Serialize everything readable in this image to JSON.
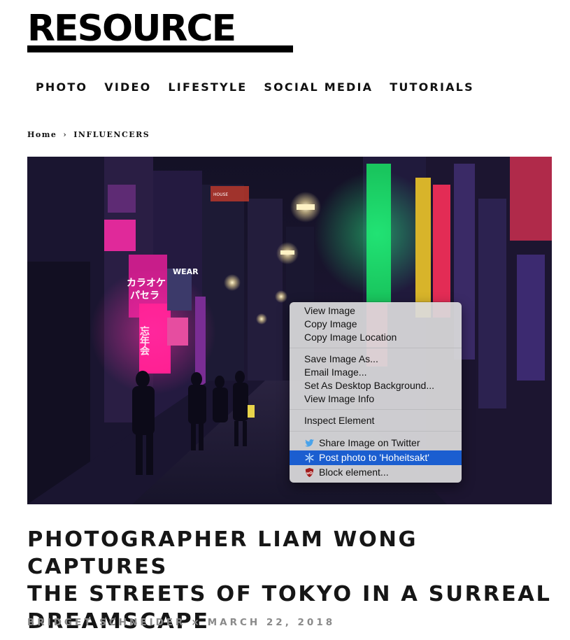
{
  "site": {
    "logo": "RESOURCE"
  },
  "nav": {
    "items": [
      "PHOTO",
      "VIDEO",
      "LIFESTYLE",
      "SOCIAL MEDIA",
      "TUTORIALS"
    ]
  },
  "breadcrumb": {
    "home": "Home",
    "separator": "›",
    "current": "INFLUENCERS"
  },
  "hero": {
    "signs": [
      "カラオケ",
      "パセラ",
      "忘年会",
      "WEAR",
      "HOUSE"
    ]
  },
  "context_menu": {
    "items": [
      "View Image",
      "Copy Image",
      "Copy Image Location",
      "Save Image As...",
      "Email Image...",
      "Set As Desktop Background...",
      "View Image Info",
      "Inspect Element",
      "Share Image on Twitter",
      "Post photo to 'Hoheitsakt'",
      "Block element..."
    ],
    "icons": [
      "twitter-icon",
      "snowflake-icon",
      "ublock-shield-icon"
    ],
    "highlight_color": "#1b5ed0"
  },
  "article": {
    "title_lines": [
      "PHOTOGRAPHER LIAM WONG CAPTURES",
      "THE STREETS OF TOKYO IN A SURREAL",
      "DREAMSCAPE"
    ],
    "author": "BRIDGET SCHNEIDER",
    "byline_separator": "×",
    "date": "MARCH 22, 2018"
  }
}
